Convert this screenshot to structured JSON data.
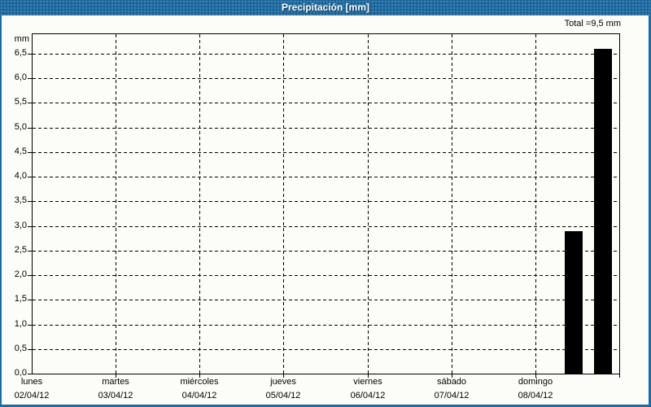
{
  "window": {
    "title": "Precipitación [mm]"
  },
  "colors": {
    "header_bg": "#1f6ba1",
    "frame_border": "#1f6ba1",
    "background": "#fdfdf8",
    "bar": "#000000",
    "text": "#000000",
    "grid": "#000000"
  },
  "total_label": "Total =9,5 mm",
  "chart_data": {
    "type": "bar",
    "title": "Precipitación [mm]",
    "unit_label": "mm",
    "ylabel": "mm",
    "ylim": [
      0,
      6.91
    ],
    "ytick_step": 0.5,
    "yticks": [
      {
        "value": 0.0,
        "label": "0,0"
      },
      {
        "value": 0.5,
        "label": "0,5"
      },
      {
        "value": 1.0,
        "label": "1,0"
      },
      {
        "value": 1.5,
        "label": "1,5"
      },
      {
        "value": 2.0,
        "label": "2,0"
      },
      {
        "value": 2.5,
        "label": "2,5"
      },
      {
        "value": 3.0,
        "label": "3,0"
      },
      {
        "value": 3.5,
        "label": "3,5"
      },
      {
        "value": 4.0,
        "label": "4,0"
      },
      {
        "value": 4.5,
        "label": "4,5"
      },
      {
        "value": 5.0,
        "label": "5,0"
      },
      {
        "value": 5.5,
        "label": "5,5"
      },
      {
        "value": 6.0,
        "label": "6,0"
      },
      {
        "value": 6.5,
        "label": "6,5"
      }
    ],
    "grid": {
      "horizontal": "dashed",
      "vertical": "dashed"
    },
    "x_axis": {
      "days": [
        {
          "name": "lunes",
          "date": "02/04/12"
        },
        {
          "name": "martes",
          "date": "03/04/12"
        },
        {
          "name": "miércoles",
          "date": "04/04/12"
        },
        {
          "name": "jueves",
          "date": "05/04/12"
        },
        {
          "name": "viernes",
          "date": "06/04/12"
        },
        {
          "name": "sábado",
          "date": "07/04/12"
        },
        {
          "name": "domingo",
          "date": "08/04/12"
        }
      ],
      "days_shown": 7
    },
    "bars": [
      {
        "day": "domingo",
        "date": "08/04/12",
        "x_frac": 0.922,
        "value_mm": 2.9
      },
      {
        "day": "domingo",
        "date": "08/04/12",
        "x_frac": 0.972,
        "value_mm": 6.6
      }
    ],
    "total_mm": 9.5,
    "legend": null
  }
}
